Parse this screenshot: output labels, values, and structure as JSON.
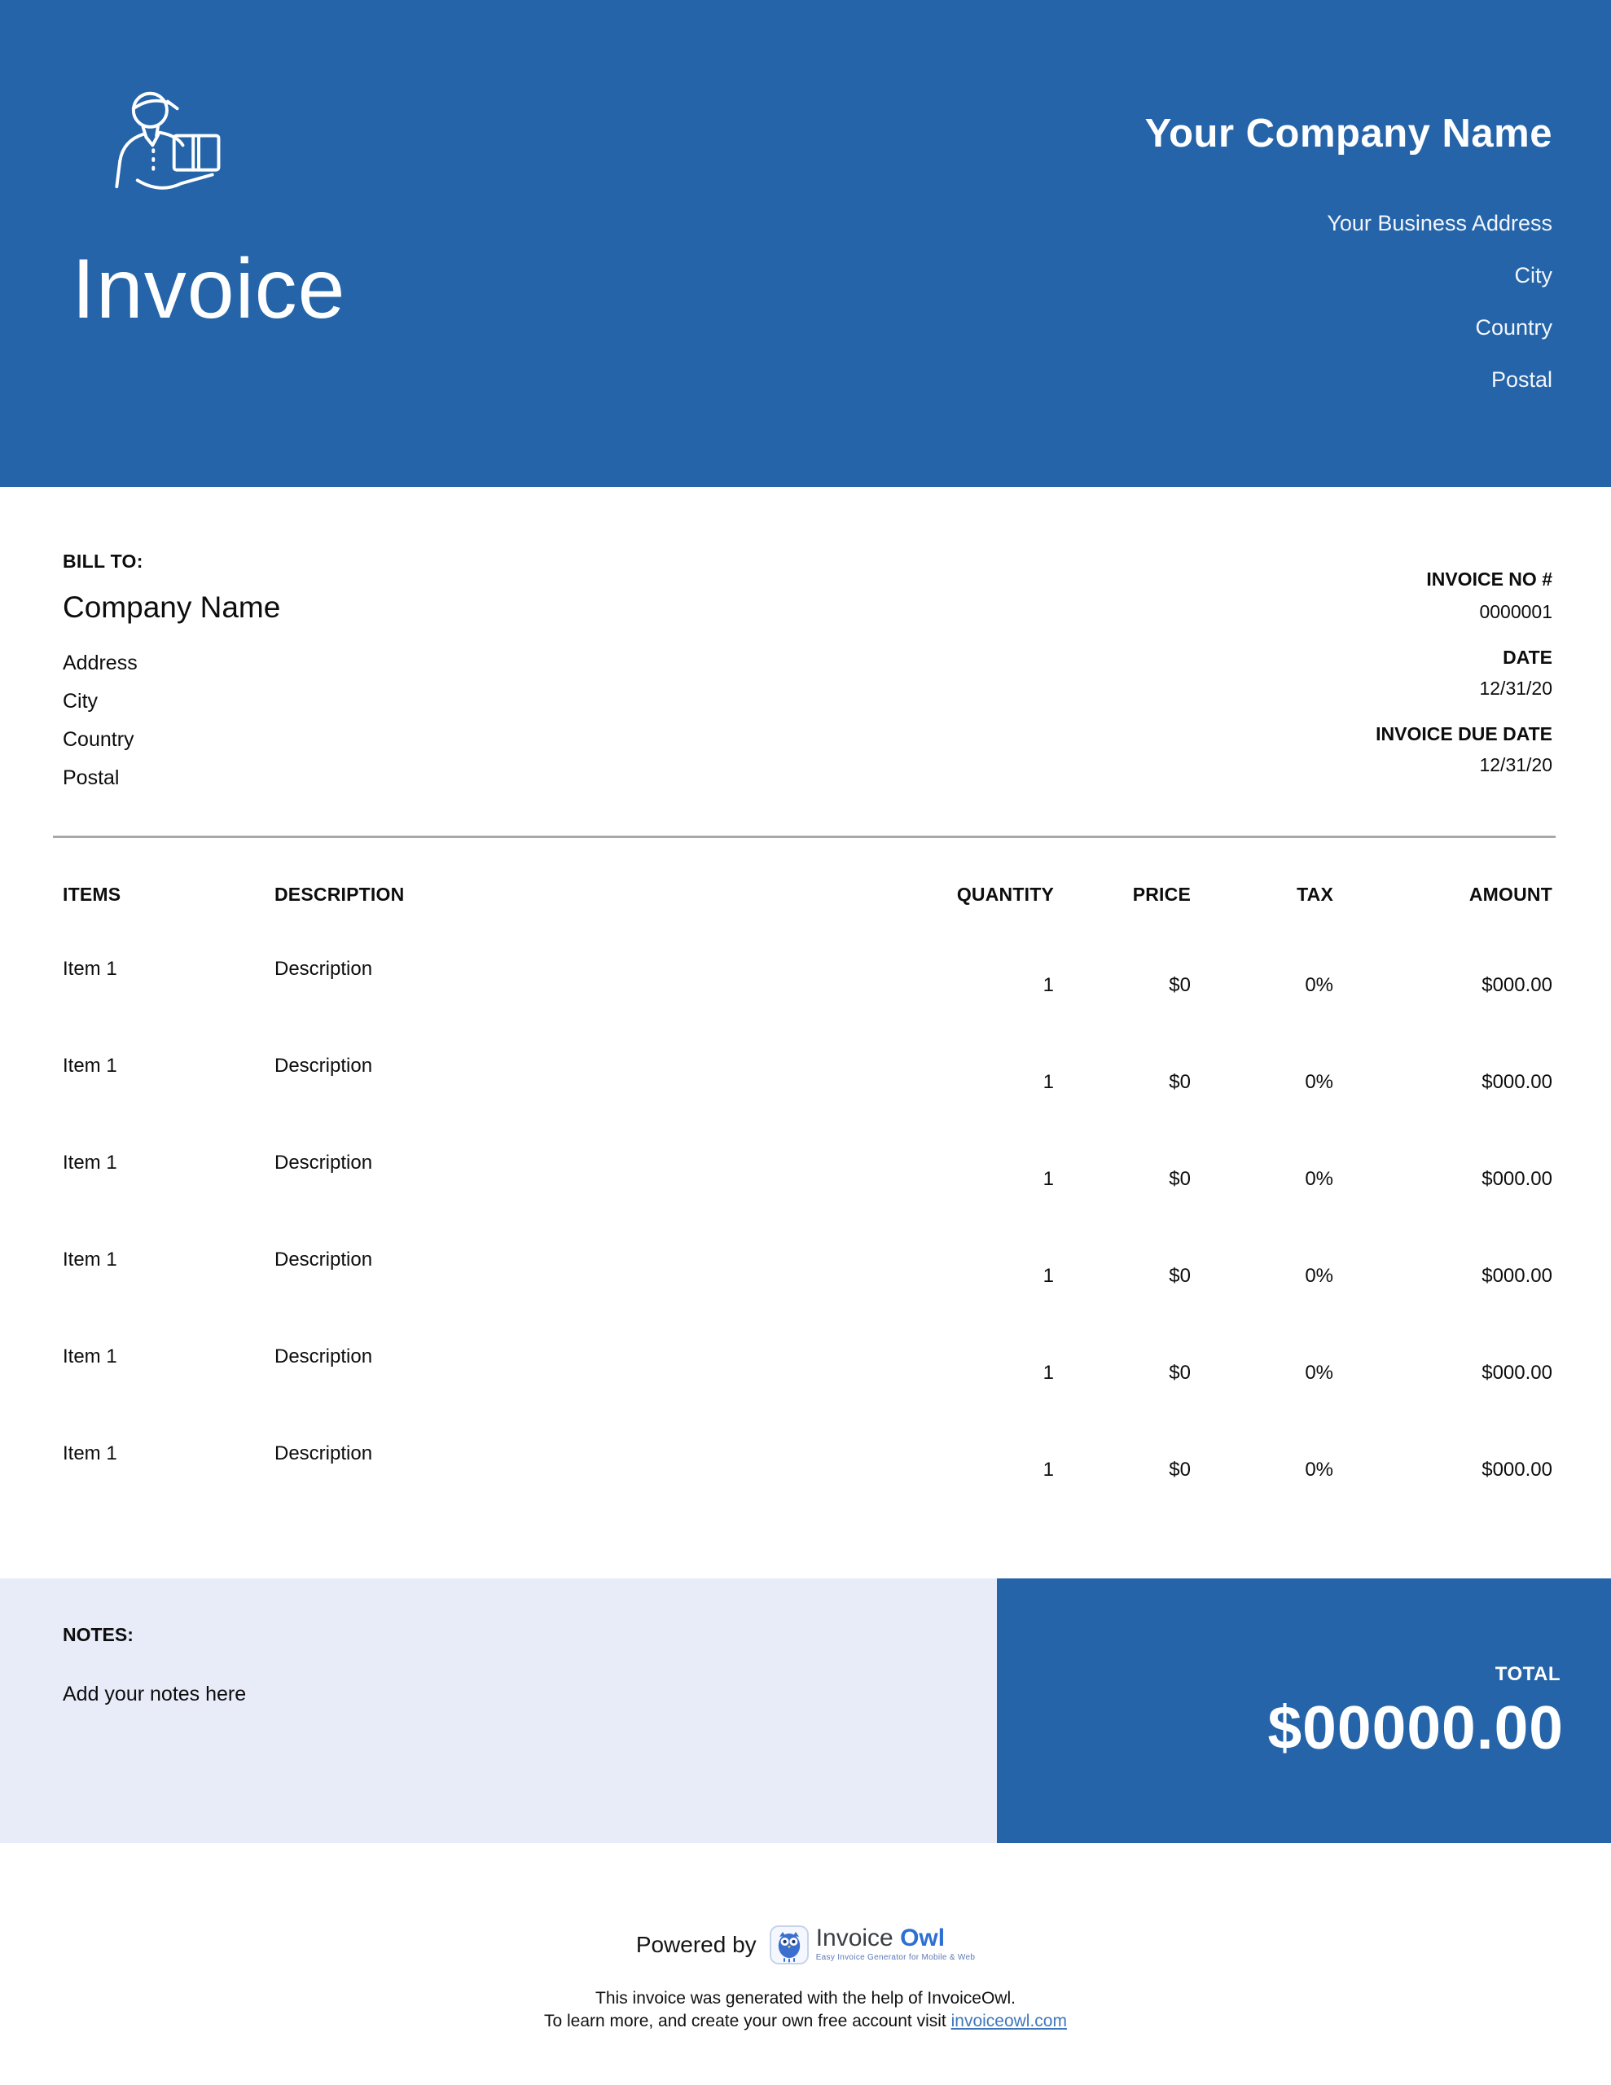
{
  "colors": {
    "header_blue": "#2564a9",
    "notes_background": "#e8ecf9",
    "divider_gray": "#a8a8a8",
    "link_blue": "#3f76bb",
    "logo_blue": "#2e6fd3"
  },
  "header": {
    "title": "Invoice",
    "logo_icon": "delivery-person-icon",
    "company_name": "Your Company Name",
    "address_lines": [
      "Your Business Address",
      "City",
      "Country",
      "Postal"
    ]
  },
  "bill_to": {
    "label": "BILL TO:",
    "company": "Company Name",
    "lines": [
      "Address",
      "City",
      "Country",
      "Postal"
    ]
  },
  "invoice_meta": {
    "number_label": "INVOICE NO #",
    "number": "0000001",
    "date_label": "DATE",
    "date": "12/31/20",
    "due_label": "INVOICE DUE DATE",
    "due_date": "12/31/20"
  },
  "table": {
    "headers": {
      "items": "ITEMS",
      "description": "DESCRIPTION",
      "quantity": "QUANTITY",
      "price": "PRICE",
      "tax": "TAX",
      "amount": "AMOUNT"
    },
    "rows": [
      {
        "item": "Item 1",
        "description": "Description",
        "quantity": "1",
        "price": "$0",
        "tax": "0%",
        "amount": "$000.00"
      },
      {
        "item": "Item 1",
        "description": "Description",
        "quantity": "1",
        "price": "$0",
        "tax": "0%",
        "amount": "$000.00"
      },
      {
        "item": "Item 1",
        "description": "Description",
        "quantity": "1",
        "price": "$0",
        "tax": "0%",
        "amount": "$000.00"
      },
      {
        "item": "Item 1",
        "description": "Description",
        "quantity": "1",
        "price": "$0",
        "tax": "0%",
        "amount": "$000.00"
      },
      {
        "item": "Item 1",
        "description": "Description",
        "quantity": "1",
        "price": "$0",
        "tax": "0%",
        "amount": "$000.00"
      },
      {
        "item": "Item 1",
        "description": "Description",
        "quantity": "1",
        "price": "$0",
        "tax": "0%",
        "amount": "$000.00"
      }
    ]
  },
  "notes": {
    "label": "NOTES:",
    "text": "Add your notes here"
  },
  "total": {
    "label": "TOTAL",
    "amount": "$00000.00"
  },
  "footer": {
    "powered_by": "Powered by",
    "logo_icon": "invoiceowl-owl-icon",
    "logo_text_invoice": "Invoice",
    "logo_text_owl": "Owl",
    "logo_tagline": "Easy Invoice Generator for Mobile & Web",
    "line1": "This invoice was generated with the help of InvoiceOwl.",
    "line2_prefix": "To learn more, and create your own free account visit ",
    "link_text": "invoiceowl.com"
  }
}
